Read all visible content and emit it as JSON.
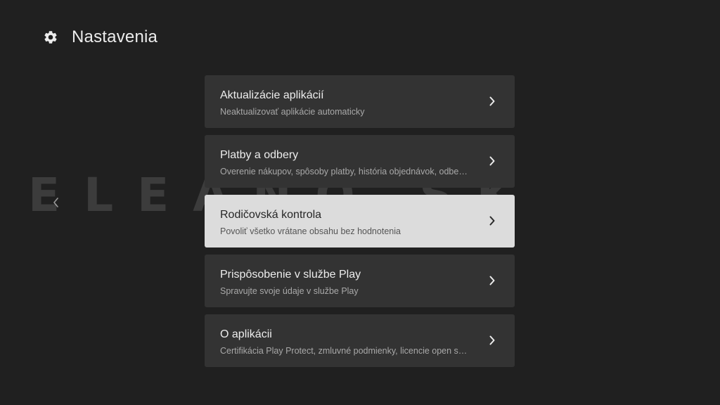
{
  "header": {
    "title": "Nastavenia",
    "icon": "gear-icon"
  },
  "watermark": "ELEANO.SK",
  "colors": {
    "background": "#202020",
    "card": "#333333",
    "card_focused": "#dcdcdc"
  },
  "items": [
    {
      "title": "Aktualizácie aplikácií",
      "subtitle": "Neaktualizovať aplikácie automaticky",
      "focused": false
    },
    {
      "title": "Platby a odbery",
      "subtitle": "Overenie nákupov, spôsoby platby, história objednávok, odbe…",
      "focused": false
    },
    {
      "title": "Rodičovská kontrola",
      "subtitle": "Povoliť všetko vrátane obsahu bez hodnotenia",
      "focused": true
    },
    {
      "title": "Prispôsobenie v službe Play",
      "subtitle": "Spravujte svoje údaje v službe Play",
      "focused": false
    },
    {
      "title": "O aplikácii",
      "subtitle": "Certifikácia Play Protect, zmluvné podmienky, licencie open s…",
      "focused": false
    }
  ]
}
